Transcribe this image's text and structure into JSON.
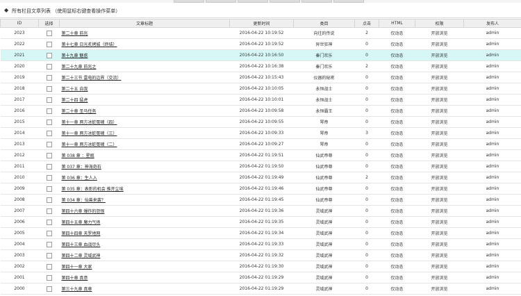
{
  "header": {
    "title": "所有栏目文章列表 （使用鼠标右键查看操作菜单）"
  },
  "columns": [
    "ID",
    "选择",
    "文章标题",
    "更新时间",
    "类目",
    "点击",
    "HTML",
    "权限",
    "发布人"
  ],
  "rows": [
    {
      "id": "2023",
      "title": "第二十章 前兆",
      "time": "2016-04-22 10:19:52",
      "category": "向往的传说",
      "clicks": "2",
      "html": "仅动态",
      "perm": "开放浏览",
      "author": "admin"
    },
    {
      "id": "2022",
      "title": "第十七章 日光炙烤城（终结）",
      "time": "2016-04-22 10:19:52",
      "category": "异世狂神",
      "clicks": "0",
      "html": "仅动态",
      "perm": "开放浏览",
      "author": "admin"
    },
    {
      "id": "2021",
      "title": "第十九章 魅惑",
      "time": "2016-04-22 10:16:50",
      "category": "秦门欢乐",
      "clicks": "0",
      "html": "仅动态",
      "perm": "开放浏览",
      "author": "admin"
    },
    {
      "id": "2020",
      "title": "第二十九章 前兆之",
      "time": "2016-04-22 10:16:38",
      "category": "秦门欢乐",
      "clicks": "2",
      "html": "仅动态",
      "perm": "开放浏览",
      "author": "admin"
    },
    {
      "id": "2019",
      "title": "第二十三节 雷电的边界（交流）",
      "time": "2016-04-22 10:15:43",
      "category": "仪器的秘密",
      "clicks": "0",
      "html": "仅动态",
      "perm": "开放浏览",
      "author": "admin"
    },
    {
      "id": "2018",
      "title": "第二十五 自我",
      "time": "2016-04-22 10:10:05",
      "category": "永恒战士",
      "clicks": "0",
      "html": "仅动态",
      "perm": "开放浏览",
      "author": "admin"
    },
    {
      "id": "2017",
      "title": "第二十四 猛虎",
      "time": "2016-04-22 10:10:01",
      "category": "永恒战士",
      "clicks": "0",
      "html": "仅动态",
      "perm": "开放浏览",
      "author": "admin"
    },
    {
      "id": "2016",
      "title": "第二十章 圣马任务",
      "time": "2016-04-22 10:09:58",
      "category": "永恒霸王",
      "clicks": "0",
      "html": "仅动态",
      "perm": "开放浏览",
      "author": "admin"
    },
    {
      "id": "2015",
      "title": "第十一章 两方冰蛇冤啸（四）",
      "time": "2016-04-22 10:09:55",
      "category": "琴帝",
      "clicks": "0",
      "html": "仅动态",
      "perm": "开放浏览",
      "author": "admin"
    },
    {
      "id": "2014",
      "title": "第十一章 两方冰蛇冤啸（三）",
      "time": "2016-04-22 10:09:33",
      "category": "琴帝",
      "clicks": "3",
      "html": "仅动态",
      "perm": "开放浏览",
      "author": "admin"
    },
    {
      "id": "2013",
      "title": "第十一章 两方冰蛇冤啸（二）",
      "time": "2016-04-22 10:09:27",
      "category": "琴帝",
      "clicks": "0",
      "html": "仅动态",
      "perm": "开放浏览",
      "author": "admin"
    },
    {
      "id": "2012",
      "title": "第 038 章 ：星瓶",
      "time": "2016-04-22 01:19:51",
      "category": "仙武帝尊",
      "clicks": "0",
      "html": "仅动态",
      "perm": "开放浏览",
      "author": "admin"
    },
    {
      "id": "2011",
      "title": "第 037 章：神海奇石",
      "time": "2016-04-22 01:19:50",
      "category": "仙武帝尊",
      "clicks": "0",
      "html": "仅动态",
      "perm": "开放浏览",
      "author": "admin"
    },
    {
      "id": "2010",
      "title": "第 036 章：生人入",
      "time": "2016-04-22 01:19:49",
      "category": "仙武帝尊",
      "clicks": "2",
      "html": "仅动态",
      "perm": "开放浏览",
      "author": "admin"
    },
    {
      "id": "2009",
      "title": "第 035 章：表彰的机会 推开尘埃",
      "time": "2016-04-22 01:19:46",
      "category": "仙武帝尊",
      "clicks": "0",
      "html": "仅动态",
      "perm": "开放浏览",
      "author": "admin"
    },
    {
      "id": "2008",
      "title": "第 034 章：仙兽来袭？",
      "time": "2016-04-22 01:19:45",
      "category": "仙武帝尊",
      "clicks": "0",
      "html": "仅动态",
      "perm": "开放浏览",
      "author": "admin"
    },
    {
      "id": "2007",
      "title": "第四十六章 爆炸的怨恨",
      "time": "2016-04-22 01:19:36",
      "category": "灵域武神",
      "clicks": "0",
      "html": "仅动态",
      "perm": "开放浏览",
      "author": "admin"
    },
    {
      "id": "2006",
      "title": "第四十五章 魔力气场",
      "time": "2016-04-22 01:19:35",
      "category": "灵域武神",
      "clicks": "0",
      "html": "仅动态",
      "perm": "开放浏览",
      "author": "admin"
    },
    {
      "id": "2005",
      "title": "第四十四章 天罗地网",
      "time": "2016-04-22 01:19:34",
      "category": "灵域武神",
      "clicks": "0",
      "html": "仅动态",
      "perm": "开放浏览",
      "author": "admin"
    },
    {
      "id": "2004",
      "title": "第四十三章 血战尽头",
      "time": "2016-04-22 01:19:33",
      "category": "灵域武神",
      "clicks": "0",
      "html": "仅动态",
      "perm": "开放浏览",
      "author": "admin"
    },
    {
      "id": "2003",
      "title": "第四十二章 灵域武神",
      "time": "2016-04-22 01:19:32",
      "category": "灵域武神",
      "clicks": "0",
      "html": "仅动态",
      "perm": "开放浏览",
      "author": "admin"
    },
    {
      "id": "2002",
      "title": "第四十一章 大家",
      "time": "2016-04-22 01:19:30",
      "category": "灵域武神",
      "clicks": "0",
      "html": "仅动态",
      "perm": "开放浏览",
      "author": "admin"
    },
    {
      "id": "2001",
      "title": "第四十章 真意",
      "time": "2016-04-22 01:19:29",
      "category": "灵域武神",
      "clicks": "0",
      "html": "仅动态",
      "perm": "开放浏览",
      "author": "admin"
    },
    {
      "id": "2000",
      "title": "第三十九章 真章",
      "time": "2016-04-22 01:19:29",
      "category": "灵域武神",
      "clicks": "0",
      "html": "仅动态",
      "perm": "开放浏览",
      "author": "admin"
    }
  ],
  "highlight_row": "2021"
}
